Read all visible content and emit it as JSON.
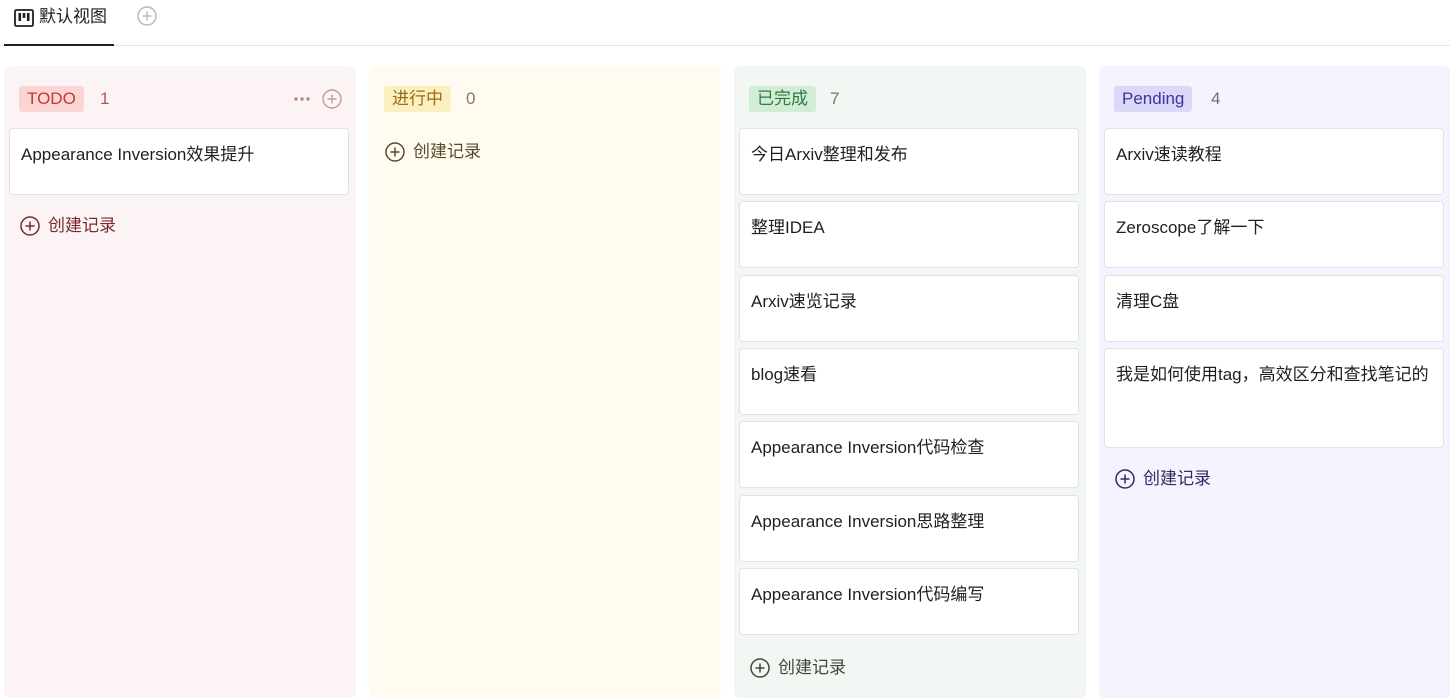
{
  "view_tab": {
    "label": "默认视图",
    "active": true
  },
  "columns": [
    {
      "tag": "TODO",
      "count": "1",
      "colors": {
        "bg": "#fbf3f4",
        "tag_bg": "#fbd4d4",
        "tag_text": "#c0393b",
        "count": "#a65c5c",
        "create": "#7a2a2a"
      },
      "cards": [
        "Appearance Inversion效果提升"
      ],
      "create_label": "创建记录"
    },
    {
      "tag": "进行中",
      "count": "0",
      "colors": {
        "bg": "#fffbf0",
        "tag_bg": "#fcefc0",
        "tag_text": "#9a6b12",
        "count": "#8a7a5a",
        "create": "#5a4a2a"
      },
      "cards": [],
      "create_label": "创建记录"
    },
    {
      "tag": "已完成",
      "count": "7",
      "colors": {
        "bg": "#f3f7f3",
        "tag_bg": "#d2ecd6",
        "tag_text": "#2f7a3f",
        "count": "#6b7b6b",
        "create": "#3a4a3a"
      },
      "cards": [
        "今日Arxiv整理和发布",
        "整理IDEA",
        "Arxiv速览记录",
        "blog速看",
        "Appearance Inversion代码检查",
        "Appearance Inversion思路整理",
        "Appearance Inversion代码编写"
      ],
      "create_label": "创建记录"
    },
    {
      "tag": "Pending",
      "count": "4",
      "colors": {
        "bg": "#f4f3fe",
        "tag_bg": "#dcd8f8",
        "tag_text": "#3e33a0",
        "count": "#6a6a8a",
        "create": "#2f2a6a"
      },
      "cards": [
        "Arxiv速读教程",
        "Zeroscope了解一下",
        "清理C盘",
        "我是如何使用tag，高效区分和查找笔记的"
      ],
      "create_label": "创建记录"
    }
  ]
}
